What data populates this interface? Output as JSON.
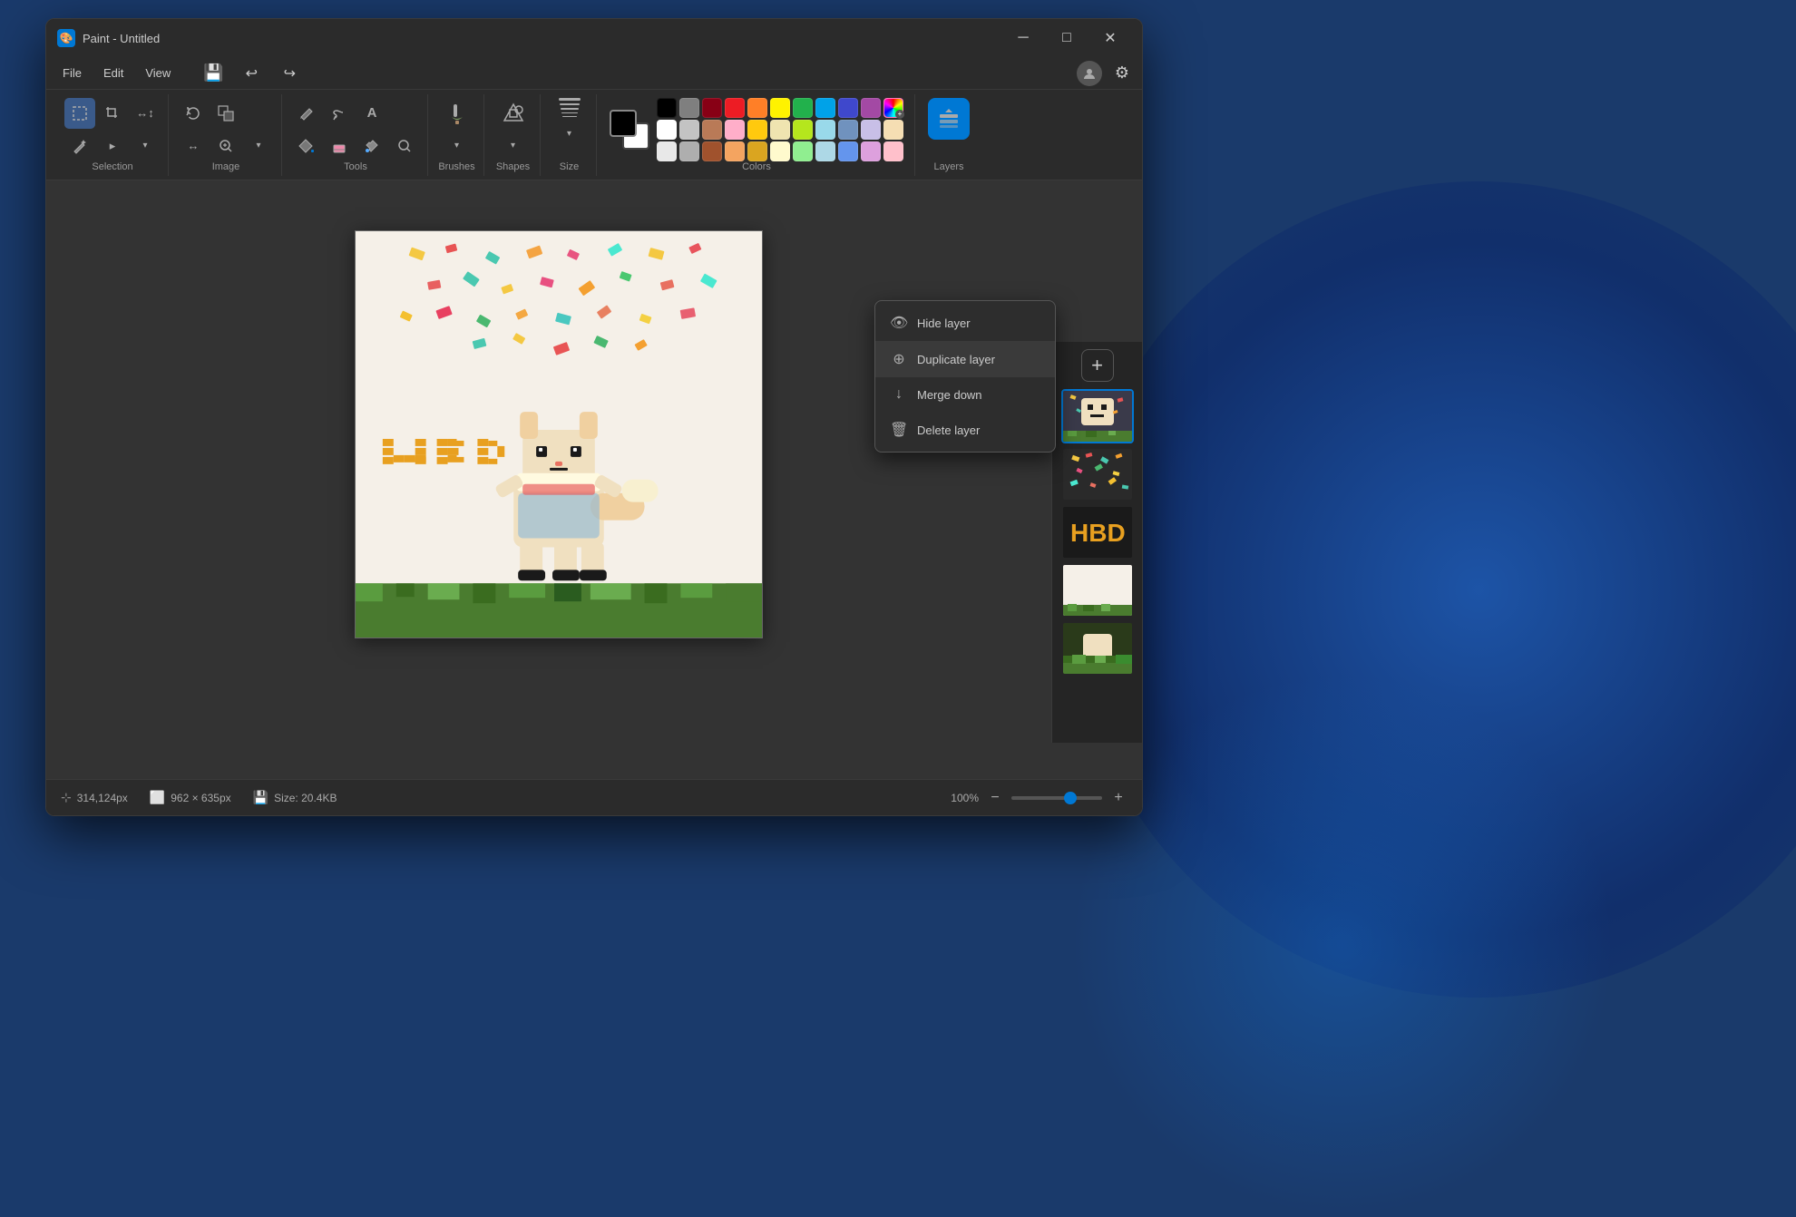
{
  "window": {
    "title": "Paint - Untitled",
    "icon": "🎨"
  },
  "titlebar": {
    "minimize_label": "─",
    "maximize_label": "□",
    "close_label": "✕"
  },
  "menu": {
    "items": [
      "File",
      "Edit",
      "View"
    ],
    "file_label": "File",
    "edit_label": "Edit",
    "view_label": "View"
  },
  "toolbar": {
    "groups": {
      "selection": {
        "label": "Selection",
        "tools": [
          "⬜",
          "✂",
          "🔄",
          "☆",
          "▸",
          "⧉"
        ]
      },
      "image": {
        "label": "Image",
        "tools": [
          "✂",
          "↩",
          "⬚",
          "🎨",
          "▸",
          "🔍"
        ]
      },
      "tools": {
        "label": "Tools",
        "tools": [
          "✏",
          "🖌",
          "A",
          "🪣",
          "⌫",
          "🔭",
          "🔍"
        ]
      },
      "brushes": {
        "label": "Brushes",
        "tools": [
          "🖌"
        ]
      },
      "shapes": {
        "label": "Shapes",
        "tools": [
          "⬡"
        ]
      },
      "size": {
        "label": "Size",
        "tools": [
          "≡"
        ]
      }
    }
  },
  "colors": {
    "label": "Colors",
    "row1": [
      "#000000",
      "#666666",
      "#c0392b",
      "#e74c3c",
      "#e67e22",
      "#f1c40f",
      "#2ecc71",
      "#1abc9c",
      "#3498db",
      "#9b59b6",
      "#e91e8c"
    ],
    "row2": [
      "#ffffff",
      "#999999",
      "#c9a882",
      "#f48fb1",
      "#ffcc80",
      "#fff176",
      "#a5d6a7",
      "#80cbc4",
      "#90caf9",
      "#ce93d8",
      "#f8bbd0"
    ],
    "row3": [
      "#eeeeee",
      "#bbbbbb",
      "#d7ccc8",
      "#ffccbc",
      "#ffe0b2",
      "#fff9c4",
      "#c8e6c9",
      "#b2dfdb",
      "#bbdefb",
      "#e1bee7",
      "#fce4ec"
    ]
  },
  "layers": {
    "label": "Layers",
    "add_button": "+",
    "items": [
      {
        "id": 1,
        "active": true,
        "color": "#3a3a3a"
      },
      {
        "id": 2,
        "active": false,
        "color": "#2a2a2a"
      },
      {
        "id": 3,
        "active": false,
        "text": "HBD",
        "color": "#1a1a1a"
      },
      {
        "id": 4,
        "active": false,
        "color": "#3a4a2a"
      },
      {
        "id": 5,
        "active": false,
        "color": "#2a3a1a"
      }
    ]
  },
  "context_menu": {
    "items": [
      {
        "icon": "👁",
        "label": "Hide layer"
      },
      {
        "icon": "⊕",
        "label": "Duplicate layer"
      },
      {
        "icon": "↓",
        "label": "Merge down"
      },
      {
        "icon": "🗑",
        "label": "Delete layer"
      }
    ]
  },
  "statusbar": {
    "cursor": "314,124px",
    "dimensions": "962 × 635px",
    "size": "Size: 20.4KB",
    "zoom": "100%",
    "zoom_minus": "−",
    "zoom_plus": "+"
  }
}
